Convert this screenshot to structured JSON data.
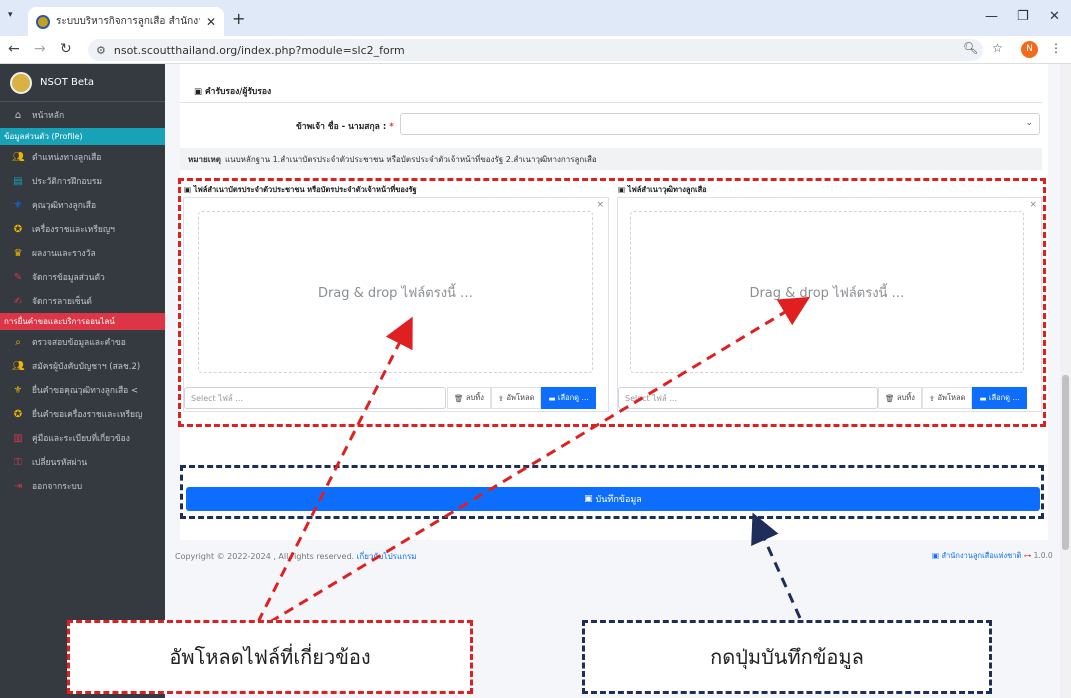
{
  "browser": {
    "tab_title": "ระบบบริหารกิจการลูกเสือ สำนักงานลูก",
    "url": "nsot.scoutthailand.org/index.php?module=slc2_form",
    "profile_initial": "N"
  },
  "sidebar": {
    "brand": "NSOT Beta",
    "home": "หน้าหลัก",
    "section_profile": "ข้อมูลส่วนตัว (Profile)",
    "profile_items": [
      {
        "label": "ตำแหน่งทางลูกเสือ",
        "icon": "users-icon",
        "color": "#f0b400"
      },
      {
        "label": "ประวัติการฝึกอบรม",
        "icon": "id-card-icon",
        "color": "#17a2b8"
      },
      {
        "label": "คุณวุฒิทางลูกเสือ",
        "icon": "scout-badge-icon",
        "color": "#0d6efd"
      },
      {
        "label": "เครื่องราชและเหรียญฯ",
        "icon": "medal-icon",
        "color": "#f0b400"
      },
      {
        "label": "ผลงานและรางวัล",
        "icon": "trophy-icon",
        "color": "#f0b400"
      },
      {
        "label": "จัดการข้อมูลส่วนตัว",
        "icon": "user-edit-icon",
        "color": "#dc3545"
      },
      {
        "label": "จัดการลายเซ็นต์",
        "icon": "signature-icon",
        "color": "#dc3545"
      }
    ],
    "section_services": "การยื่นคำขอและบริการออนไลน์",
    "service_items": [
      {
        "label": "ตรวจสอบข้อมูลและคำขอ",
        "icon": "search-icon",
        "color": "#f0b400"
      },
      {
        "label": "สมัครผู้บังคับบัญชาฯ (สลช.2)",
        "icon": "users-icon",
        "color": "#f0b400"
      },
      {
        "label": "ยื่นคำขอคุณวุฒิทางลูกเสือ  <",
        "icon": "scout-badge-icon",
        "color": "#f0b400"
      },
      {
        "label": "ยื่นคำขอเครื่องราชและเหรียญ",
        "icon": "medal-icon",
        "color": "#f0b400"
      },
      {
        "label": "คู่มือและระเบียบที่เกี่ยวข้อง",
        "icon": "book-icon",
        "color": "#dc3545"
      },
      {
        "label": "เปลี่ยนรหัสผ่าน",
        "icon": "key-icon",
        "color": "#dc3545"
      },
      {
        "label": "ออกจากระบบ",
        "icon": "logout-icon",
        "color": "#dc3545"
      }
    ]
  },
  "form": {
    "section_title": "คำรับรอง/ผู้รับรอง",
    "name_label": "ข้าพเจ้า ชื่อ - นามสกุล :",
    "required_mark": "*",
    "note_label": "หมายเหตุ",
    "note_text": "แนบหลักฐาน 1.สำเนาบัตรประจำตัวประชาชน หรือบัตรประจำตัวเจ้าหน้าที่ของรัฐ 2.สำเนาวุฒิทางการลูกเสือ",
    "uploads": [
      {
        "title": "ไฟล์สำเนาบัตรประจำตัวประชาชน หรือบัตรประจำตัวเจ้าหน้าที่ของรัฐ",
        "drop_text": "Drag & drop ไฟล์ตรงนี้ …",
        "placeholder": "Select ไฟล์ ...",
        "remove": "ลบทิ้ง",
        "upload": "อัพโหลด",
        "browse": "เลือกดู …"
      },
      {
        "title": "ไฟล์สำเนาวุฒิทางลูกเสือ",
        "drop_text": "Drag & drop ไฟล์ตรงนี้ …",
        "placeholder": "Select ไฟล์ ...",
        "remove": "ลบทิ้ง",
        "upload": "อัพโหลด",
        "browse": "เลือกดู …"
      }
    ],
    "save_button": "บันทึกข้อมูล"
  },
  "footer": {
    "copyright": "Copyright © 2022-2024 , All rights reserved.",
    "about": "เกี่ยวกับโปรแกรม",
    "org": "สำนักงานลูกเสือแห่งชาติ",
    "version": "1.0.0"
  },
  "annotations": {
    "upload_callout": "อัพโหลดไฟล์ที่เกี่ยวข้อง",
    "save_callout": "กดปุ่มบันทึกข้อมูล",
    "red_color": "#e02020",
    "navy_color": "#1f2d5a"
  }
}
